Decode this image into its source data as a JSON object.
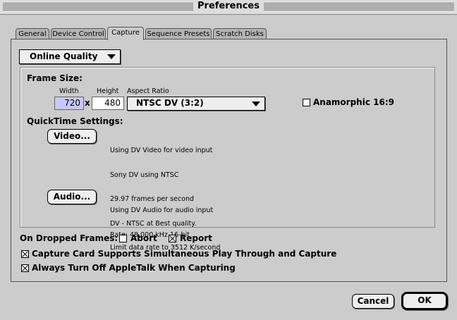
{
  "window": {
    "title": "Preferences"
  },
  "tabs": [
    {
      "label": "General"
    },
    {
      "label": "Device Control"
    },
    {
      "label": "Capture"
    },
    {
      "label": "Sequence Presets"
    },
    {
      "label": "Scratch Disks"
    }
  ],
  "active_tab": "Capture",
  "quality_popup": {
    "value": "Online Quality"
  },
  "frame_size": {
    "heading": "Frame Size:",
    "width_label": "Width",
    "height_label": "Height",
    "aspect_label": "Aspect Ratio",
    "width": "720",
    "x": "x",
    "height": "480",
    "aspect": "NTSC DV (3:2)",
    "anamorphic_label": "Anamorphic 16:9",
    "anamorphic_checked": false
  },
  "quicktime": {
    "heading": "QuickTime Settings:",
    "video_button": "Video...",
    "video_desc": [
      "Using DV Video for video input",
      "Sony DV using NTSC",
      "29.97 frames per second",
      "DV - NTSC at Best quality.",
      "Limit data rate to 3512 K/second"
    ],
    "audio_button": "Audio...",
    "audio_desc": [
      "Using DV Audio for audio input",
      "Rate: 48.000 kHz 16-bit"
    ]
  },
  "dropped_frames": {
    "label": "On Dropped Frames:",
    "abort_label": "Abort",
    "abort_checked": false,
    "report_label": "Report",
    "report_checked": true
  },
  "options": [
    {
      "label": "Capture Card Supports Simultaneous Play Through and Capture",
      "checked": true
    },
    {
      "label": "Always Turn Off AppleTalk When Capturing",
      "checked": true
    }
  ],
  "buttons": {
    "cancel": "Cancel",
    "ok": "OK"
  },
  "icons": {
    "popup_arrow": "triangle-down-icon",
    "checkbox_mark": "x-mark-icon"
  }
}
